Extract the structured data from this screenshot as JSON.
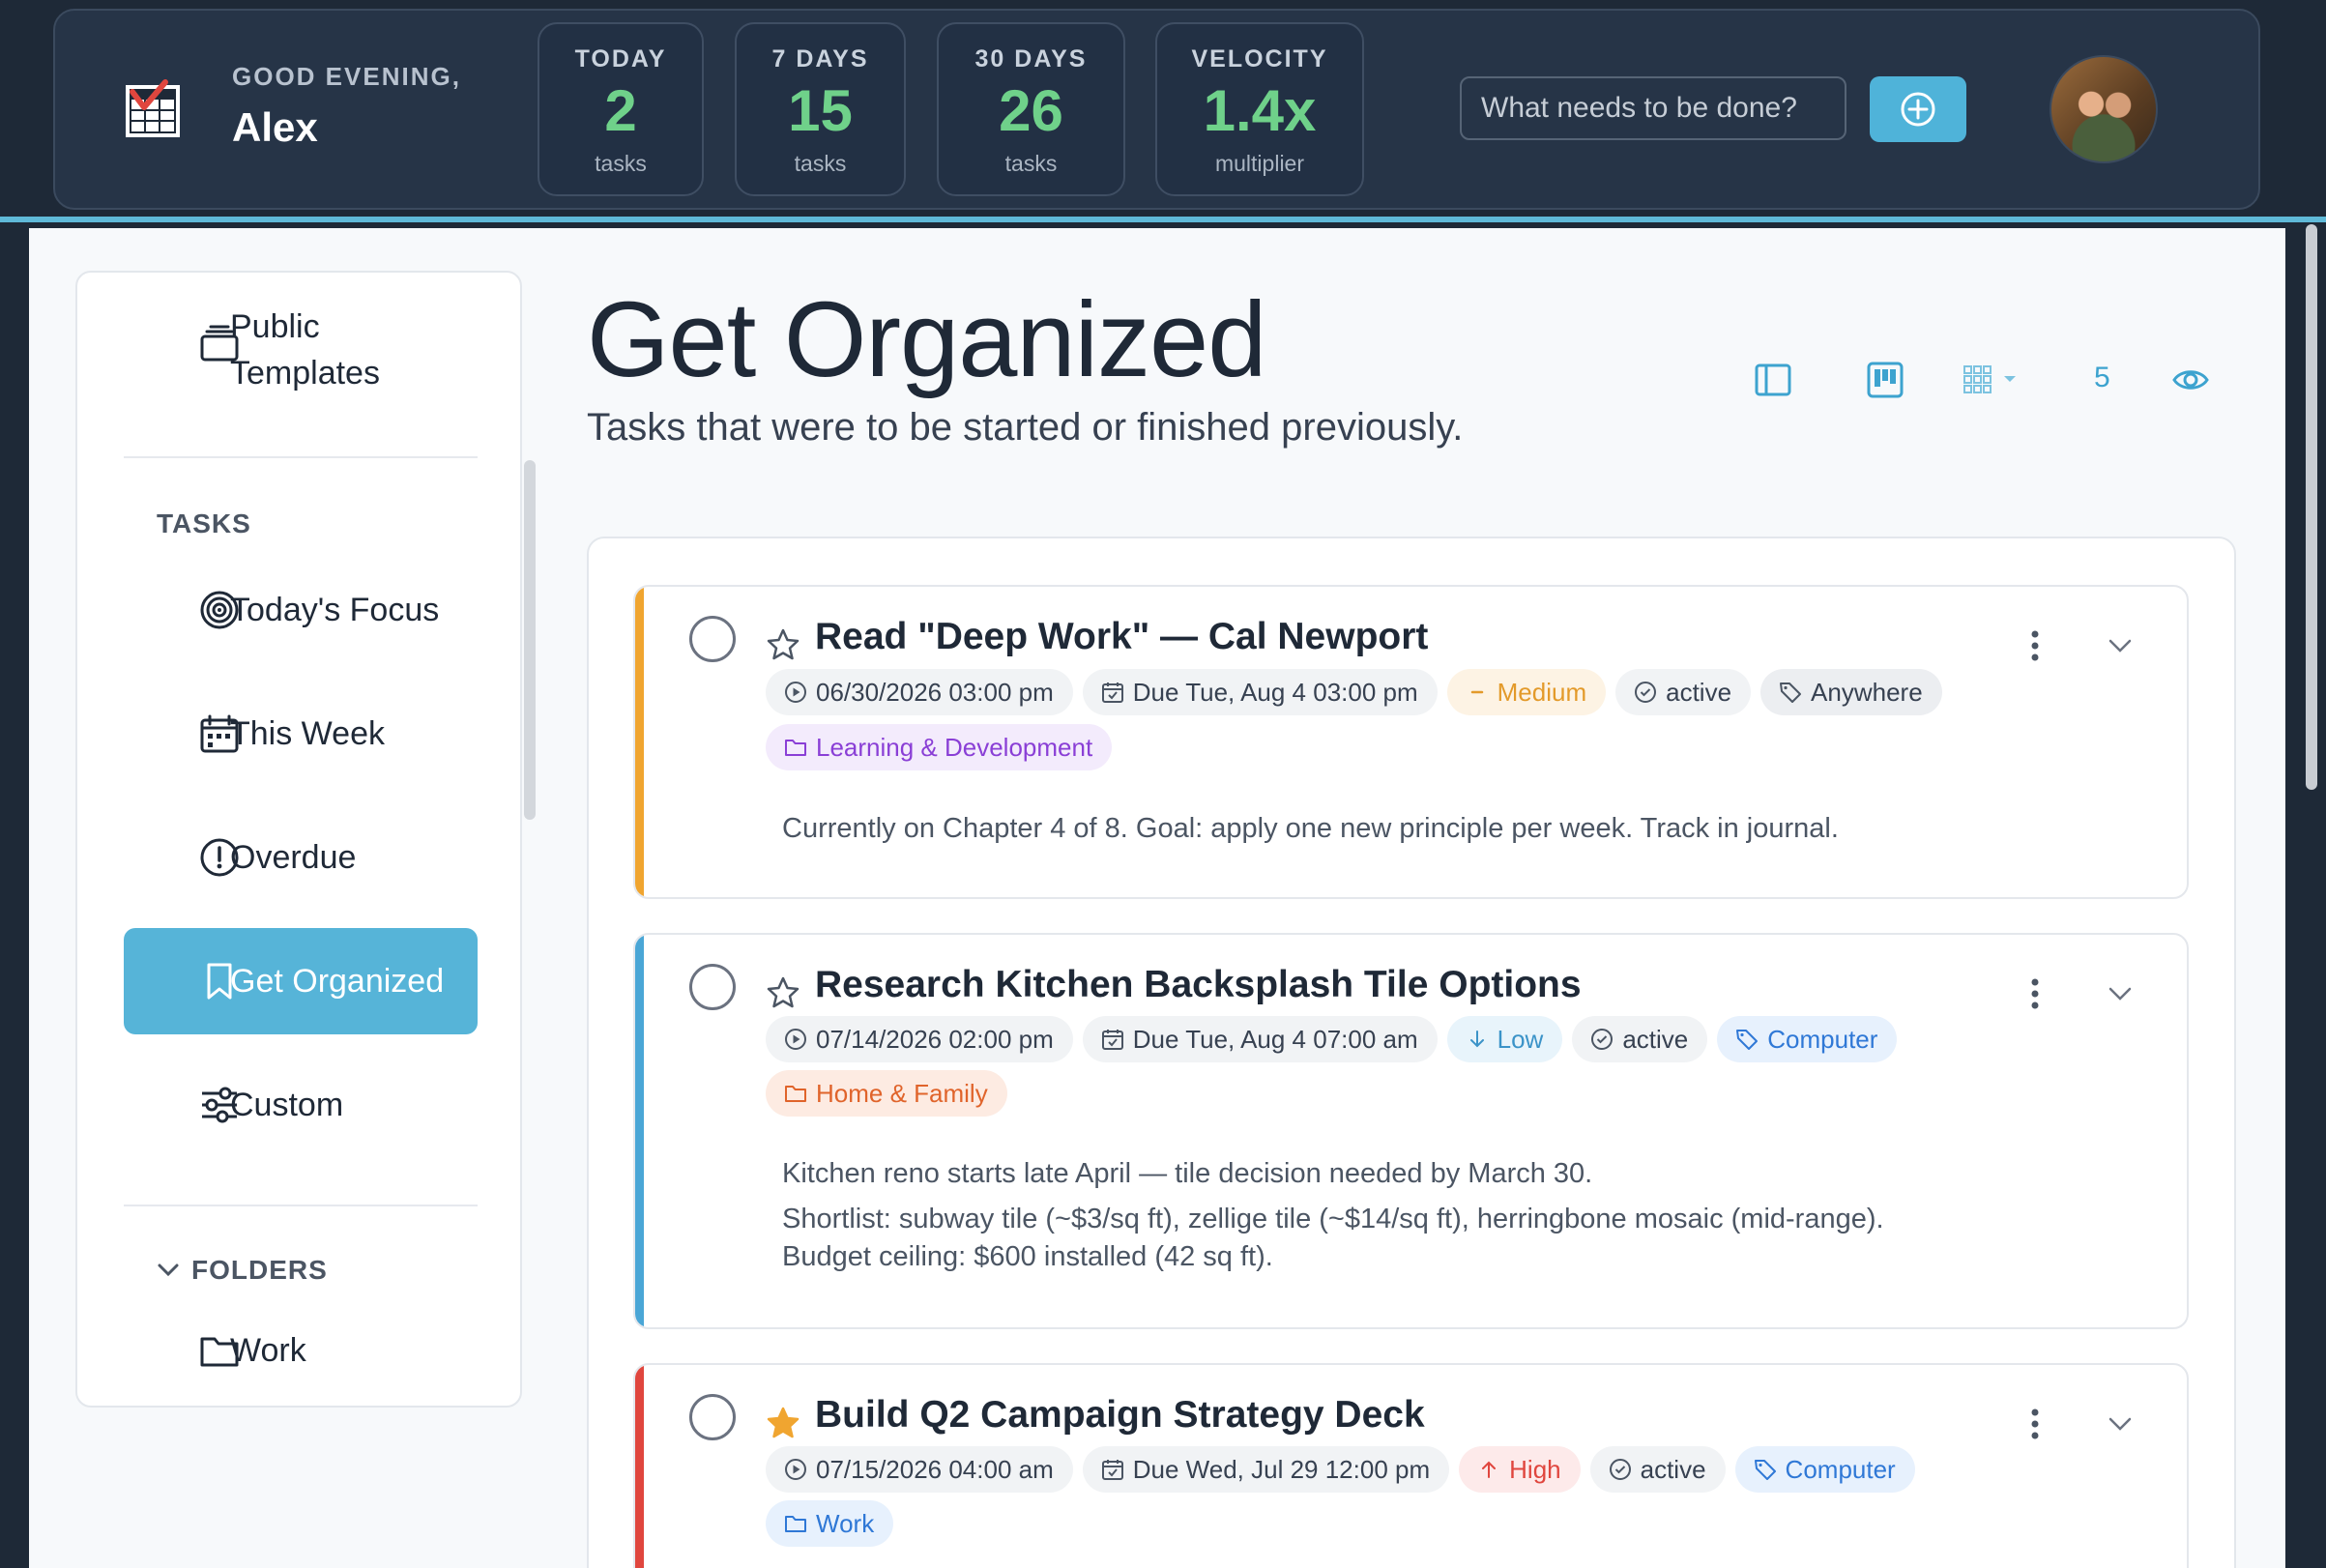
{
  "header": {
    "greeting": "GOOD EVENING,",
    "user_name": "Alex",
    "stats": [
      {
        "label": "TODAY",
        "value": "2",
        "sub": "tasks"
      },
      {
        "label": "7 DAYS",
        "value": "15",
        "sub": "tasks"
      },
      {
        "label": "30 DAYS",
        "value": "26",
        "sub": "tasks"
      },
      {
        "label": "VELOCITY",
        "value": "1.4x",
        "sub": "multiplier"
      }
    ],
    "quick_add_placeholder": "What needs to be done?"
  },
  "sidebar": {
    "templates_label": "Public\nTemplates",
    "tasks_section": "TASKS",
    "items": [
      {
        "label": "Today's Focus",
        "icon": "target-icon"
      },
      {
        "label": "This Week",
        "icon": "calendar-week-icon"
      },
      {
        "label": "Overdue",
        "icon": "alert-circle-icon"
      },
      {
        "label": "Get Organized",
        "icon": "bookmark-icon",
        "active": true
      },
      {
        "label": "Custom",
        "icon": "sliders-icon"
      }
    ],
    "folders_section": "FOLDERS",
    "folders": [
      {
        "label": "Work",
        "icon": "folder-icon"
      }
    ]
  },
  "main": {
    "title": "Get Organized",
    "subtitle": "Tasks that were to be started or finished previously.",
    "count": "5"
  },
  "tasks": [
    {
      "title": "Read \"Deep Work\" — Cal Newport",
      "starred": false,
      "accent": "#f0a530",
      "start": "06/30/2026 03:00 pm",
      "due": "Due Tue, Aug 4 03:00 pm",
      "priority": "Medium",
      "status": "active",
      "context": "Anywhere",
      "folder": "Learning & Development",
      "notes": [
        "Currently on Chapter 4 of 8. Goal: apply one new principle per week. Track in journal."
      ]
    },
    {
      "title": "Research Kitchen Backsplash Tile Options",
      "starred": false,
      "accent": "#4aa6d6",
      "start": "07/14/2026 02:00 pm",
      "due": "Due Tue, Aug 4 07:00 am",
      "priority": "Low",
      "status": "active",
      "context": "Computer",
      "folder": "Home & Family",
      "notes": [
        "Kitchen reno starts late April — tile decision needed by March 30.",
        "Shortlist: subway tile (~$3/sq ft), zellige tile (~$14/sq ft), herringbone mosaic (mid-range).",
        "Budget ceiling: $600 installed (42 sq ft)."
      ]
    },
    {
      "title": "Build Q2 Campaign Strategy Deck",
      "starred": true,
      "accent": "#e0463e",
      "start": "07/15/2026 04:00 am",
      "due": "Due Wed, Jul 29 12:00 pm",
      "priority": "High",
      "status": "active",
      "context": "Computer",
      "folder": "Work",
      "notes": []
    }
  ]
}
